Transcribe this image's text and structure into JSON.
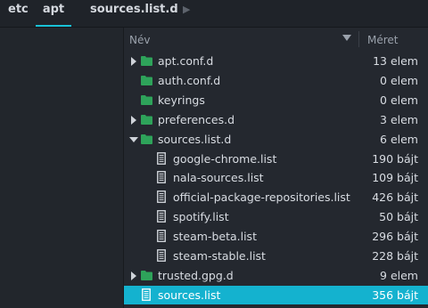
{
  "breadcrumbs": [
    {
      "label": "etc"
    },
    {
      "label": "apt"
    },
    {
      "label": "sources.list.d"
    }
  ],
  "header": {
    "name_label": "Név",
    "size_label": "Méret"
  },
  "colors": {
    "accent": "#14b2cf",
    "folder": "#2ea35a"
  },
  "items": [
    {
      "name": "apt.conf.d",
      "size": "13 elem",
      "type": "folder",
      "expander": "collapsed"
    },
    {
      "name": "auth.conf.d",
      "size": "0 elem",
      "type": "folder",
      "expander": "none"
    },
    {
      "name": "keyrings",
      "size": "0 elem",
      "type": "folder",
      "expander": "none"
    },
    {
      "name": "preferences.d",
      "size": "3 elem",
      "type": "folder",
      "expander": "collapsed"
    },
    {
      "name": "sources.list.d",
      "size": "6 elem",
      "type": "folder",
      "expander": "expanded"
    },
    {
      "name": "google-chrome.list",
      "size": "190 bájt",
      "type": "file"
    },
    {
      "name": "nala-sources.list",
      "size": "109 bájt",
      "type": "file"
    },
    {
      "name": "official-package-repositories.list",
      "size": "426 bájt",
      "type": "file"
    },
    {
      "name": "spotify.list",
      "size": "50 bájt",
      "type": "file"
    },
    {
      "name": "steam-beta.list",
      "size": "296 bájt",
      "type": "file"
    },
    {
      "name": "steam-stable.list",
      "size": "228 bájt",
      "type": "file"
    },
    {
      "name": "trusted.gpg.d",
      "size": "9 elem",
      "type": "folder",
      "expander": "collapsed"
    },
    {
      "name": "sources.list",
      "size": "356 bájt",
      "type": "file",
      "selected": true
    }
  ]
}
